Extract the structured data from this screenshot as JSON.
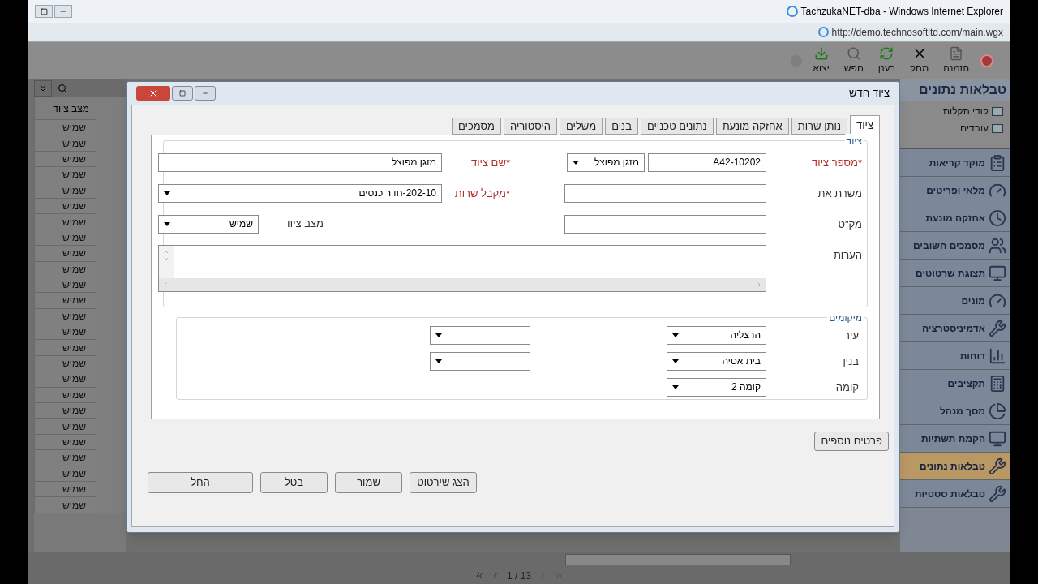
{
  "browser": {
    "title": "TachzukaNET-dba - Windows Internet Explorer",
    "url": "http://demo.technosoftltd.com/main.wgx"
  },
  "toolbar": [
    {
      "label": "הזמנה",
      "disabled": false
    },
    {
      "label": "מחק",
      "disabled": false
    },
    {
      "label": "רענן",
      "disabled": false
    },
    {
      "label": "חפש",
      "disabled": false
    },
    {
      "label": "יצוא",
      "disabled": false
    }
  ],
  "grid": {
    "columns": [
      "מצב ציוד"
    ],
    "rows": [
      "שמיש",
      "שמיש",
      "שמיש",
      "שמיש",
      "שמיש",
      "שמיש",
      "שמיש",
      "שמיש",
      "שמיש",
      "שמיש",
      "שמיש",
      "שמיש",
      "שמיש",
      "שמיש",
      "שמיש",
      "שמיש",
      "שמיש",
      "שמיש",
      "שמיש",
      "שמיש",
      "שמיש",
      "שמיש",
      "שמיש",
      "שמיש",
      "שמיש"
    ]
  },
  "sidebar": {
    "title": "טבלאות נתונים",
    "tree": [
      "קודי תקלות",
      "עובדים"
    ],
    "items": [
      {
        "label": "מוקד קריאות",
        "selected": false
      },
      {
        "label": "מלאי ופריטים",
        "selected": false
      },
      {
        "label": "אחזקה מונעת",
        "selected": false
      },
      {
        "label": "מסמכים חשובים",
        "selected": false
      },
      {
        "label": "תצוגת שרטוטים",
        "selected": false
      },
      {
        "label": "מונים",
        "selected": false
      },
      {
        "label": "אדמיניסטרציה",
        "selected": false
      },
      {
        "label": "דוחות",
        "selected": false
      },
      {
        "label": "תקציבים",
        "selected": false
      },
      {
        "label": "מסך מנהל",
        "selected": false
      },
      {
        "label": "הקמת תשתיות",
        "selected": false
      },
      {
        "label": "טבלאות נתונים",
        "selected": true
      },
      {
        "label": "טבלאות סטטיות",
        "selected": false
      }
    ]
  },
  "dialog": {
    "title": "ציוד חדש",
    "tabs": [
      {
        "label": "ציוד",
        "selected": true
      },
      {
        "label": "נותן שרות",
        "selected": false
      },
      {
        "label": "אחזקה מונעת",
        "selected": false
      },
      {
        "label": "נתונים טכניים",
        "selected": false
      },
      {
        "label": "בנים",
        "selected": false
      },
      {
        "label": "משלים",
        "selected": false
      },
      {
        "label": "היסטוריה",
        "selected": false
      },
      {
        "label": "מסמכים",
        "selected": false
      }
    ],
    "equipment": {
      "legend": "ציוד",
      "number": {
        "label": "*מספר ציוד",
        "required": true,
        "value": "A42-10202",
        "type": "מזגן מפוצל"
      },
      "name": {
        "label": "*שם ציוד",
        "required": true,
        "value": "מזגן מפוצל"
      },
      "serves": {
        "label": "משרת את",
        "required": false
      },
      "receiver": {
        "label": "*מקבל שרות",
        "required": true,
        "value": "202-10-חדר כנסים"
      },
      "catalog": {
        "label": "מק\"ט",
        "required": false
      },
      "status": {
        "label": "מצב ציוד",
        "value": "שמיש"
      },
      "notes": {
        "label": "הערות"
      }
    },
    "locations": {
      "legend": "מיקומים",
      "rows": [
        {
          "label": "עיר",
          "value": "הרצליה",
          "extra": true
        },
        {
          "label": "בנין",
          "value": "בית אסיה",
          "extra": true
        },
        {
          "label": "קומה",
          "value": "קומה 2",
          "extra": false
        }
      ]
    },
    "more_button": "פרטים נוספים",
    "buttons": [
      "הצג שירטוט",
      "שמור",
      "בטל",
      "החל"
    ]
  },
  "pager": "1 / 13"
}
